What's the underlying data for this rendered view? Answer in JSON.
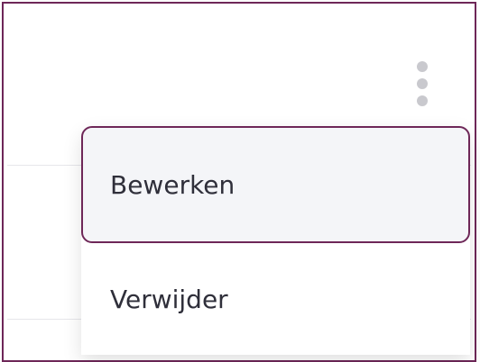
{
  "menu": {
    "items": [
      {
        "label": "Bewerken",
        "state": "focused"
      },
      {
        "label": "Verwijder",
        "state": "default"
      }
    ]
  },
  "icons": {
    "more": "more-vertical-icon"
  },
  "colors": {
    "focus_border": "#6e2758",
    "item_hover_bg": "#f4f5f8",
    "text": "#2f2f3a",
    "icon": "#c9c9ce",
    "divider": "#e6e6ea"
  }
}
